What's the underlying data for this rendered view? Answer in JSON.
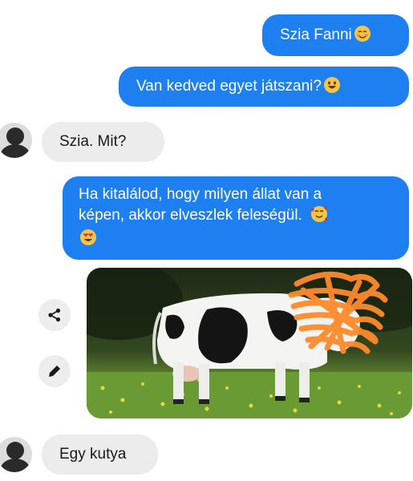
{
  "messages": {
    "m1": {
      "text": "Szia Fanni"
    },
    "m2": {
      "text": "Van kedved egyet játszani?"
    },
    "m3": {
      "text": "Szia. Mit?"
    },
    "m4": {
      "line1": "Ha kitalálod, hogy milyen állat van a",
      "line2": "képen, akkor elveszlek feleségül."
    },
    "m5": {
      "text": "Egy kutya"
    }
  },
  "icons": {
    "emoji_smile_blush": "smiling-face-with-blush",
    "emoji_grin": "slightly-smiling-face",
    "emoji_hearts": "smiling-face-with-hearts",
    "emoji_heart_eyes": "heart-eyes-face",
    "share": "share-icon",
    "edit": "pencil-icon"
  },
  "colors": {
    "sent_bubble": "#1e7ff0",
    "received_bubble": "#ececec",
    "redaction_scribble": "#ff8a2b"
  }
}
